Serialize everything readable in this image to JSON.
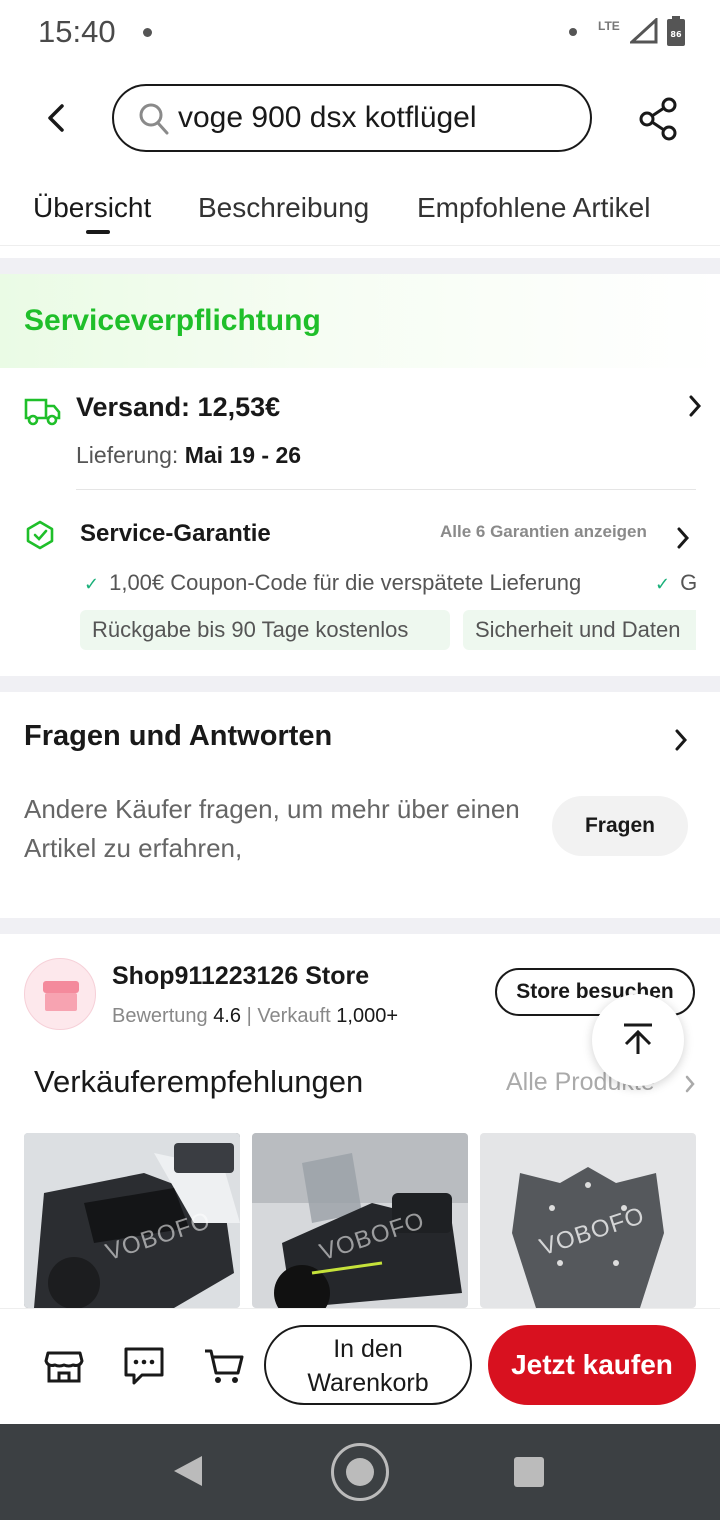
{
  "status_bar": {
    "time": "15:40",
    "network": "LTE",
    "battery": "86"
  },
  "header": {
    "search_query": "voge 900 dsx kotflügel"
  },
  "tabs": [
    {
      "label": "Übersicht",
      "active": true
    },
    {
      "label": "Beschreibung",
      "active": false
    },
    {
      "label": "Empfohlene Artikel",
      "active": false
    }
  ],
  "service": {
    "title": "Serviceverpflichtung",
    "shipping_label": "Versand: 12,53€",
    "delivery_prefix": "Lieferung:",
    "delivery_dates": "Mai 19 - 26",
    "guarantee_label": "Service-Garantie",
    "guarantee_all": "Alle 6 Garantien anzeigen",
    "guarantee_item_1": "1,00€ Coupon-Code für die verspätete Lieferung",
    "guarantee_item_2": "G",
    "chip_1": "Rückgabe bis 90 Tage kostenlos",
    "chip_2": "Sicherheit und Daten"
  },
  "qa": {
    "title": "Fragen und Antworten",
    "text": "Andere Käufer fragen, um mehr über einen Artikel zu erfahren,",
    "ask_button": "Fragen"
  },
  "store": {
    "name": "Shop911223126 Store",
    "rating_label": "Bewertung",
    "rating_value": "4.6",
    "sold_label": "| Verkauft",
    "sold_value": "1,000+",
    "visit_button": "Store besuchen"
  },
  "recommendations": {
    "title": "Verkäuferempfehlungen",
    "all_products": "Alle Produkte",
    "watermark": "VOBOFO"
  },
  "action_bar": {
    "add_to_cart_line1": "In den",
    "add_to_cart_line2": "Warenkorb",
    "buy_now": "Jetzt kaufen"
  },
  "colors": {
    "service_green": "#1fbf2a",
    "buy_red": "#d8111f",
    "check_teal": "#1ab07a"
  }
}
